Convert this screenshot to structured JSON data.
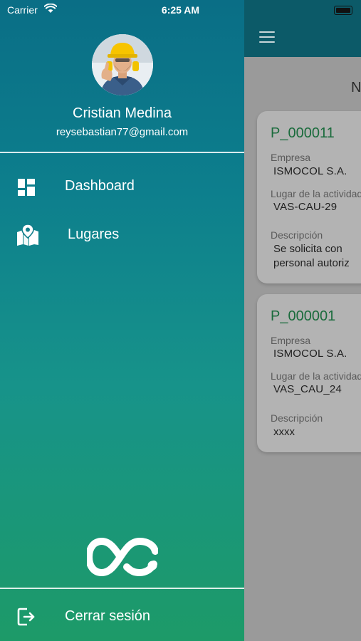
{
  "status_bar": {
    "carrier": "Carrier",
    "time": "6:25 AM"
  },
  "drawer": {
    "user": {
      "name": "Cristian Medina",
      "email": "reysebastian77@gmail.com"
    },
    "menu": [
      {
        "label": "Dashboard",
        "icon": "dashboard-icon"
      },
      {
        "label": "Lugares",
        "icon": "map-pin-icon"
      }
    ],
    "logout_label": "Cerrar sesión",
    "colors": {
      "gradient_top": "#0a6e86",
      "gradient_bottom": "#1d9a68"
    }
  },
  "background": {
    "title_fragment": "N",
    "cards": [
      {
        "code": "P_000011",
        "empresa_label": "Empresa",
        "empresa": "ISMOCOL S.A.",
        "lugar_label": "Lugar de la actividad",
        "lugar": "VAS-CAU-29",
        "descripcion_label": "Descripción",
        "descripcion_line1": "Se solicita con",
        "descripcion_line2": "personal autoriz"
      },
      {
        "code": "P_000001",
        "empresa_label": "Empresa",
        "empresa": "ISMOCOL S.A.",
        "lugar_label": "Lugar de la actividad",
        "lugar": "VAS_CAU_24",
        "descripcion_label": "Descripción",
        "descripcion_line1": "xxxx"
      }
    ]
  }
}
